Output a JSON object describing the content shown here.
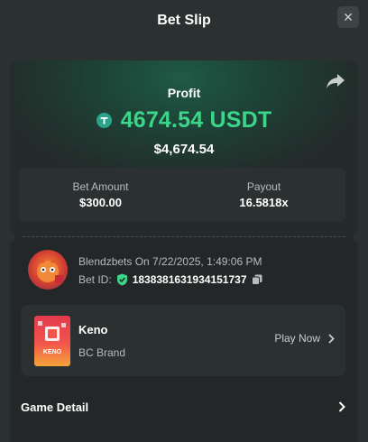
{
  "header": {
    "title": "Bet Slip",
    "close_icon": "close-icon"
  },
  "profit": {
    "label": "Profit",
    "amount": "4674.54 USDT",
    "usd_value": "$4,674.54",
    "coin_icon": "tether-usdt-icon",
    "share_icon": "share-icon"
  },
  "stats": {
    "bet_amount_label": "Bet Amount",
    "bet_amount_value": "$300.00",
    "payout_label": "Payout",
    "payout_value": "16.5818x"
  },
  "bet_info": {
    "user_line": "Blendzbets On 7/22/2025, 1:49:06 PM",
    "bet_id_label": "Bet ID:",
    "bet_id_value": "1838381631934151737",
    "verified_icon": "shield-check-icon",
    "copy_icon": "copy-icon"
  },
  "game": {
    "name": "Keno",
    "brand": "BC Brand",
    "thumb_text": "KENO",
    "play_label": "Play Now"
  },
  "footer": {
    "game_detail_label": "Game Detail"
  },
  "colors": {
    "background": "#2b3031",
    "card": "#232728",
    "accent_green": "#3bd68a",
    "muted_text": "#b6bcbc"
  }
}
